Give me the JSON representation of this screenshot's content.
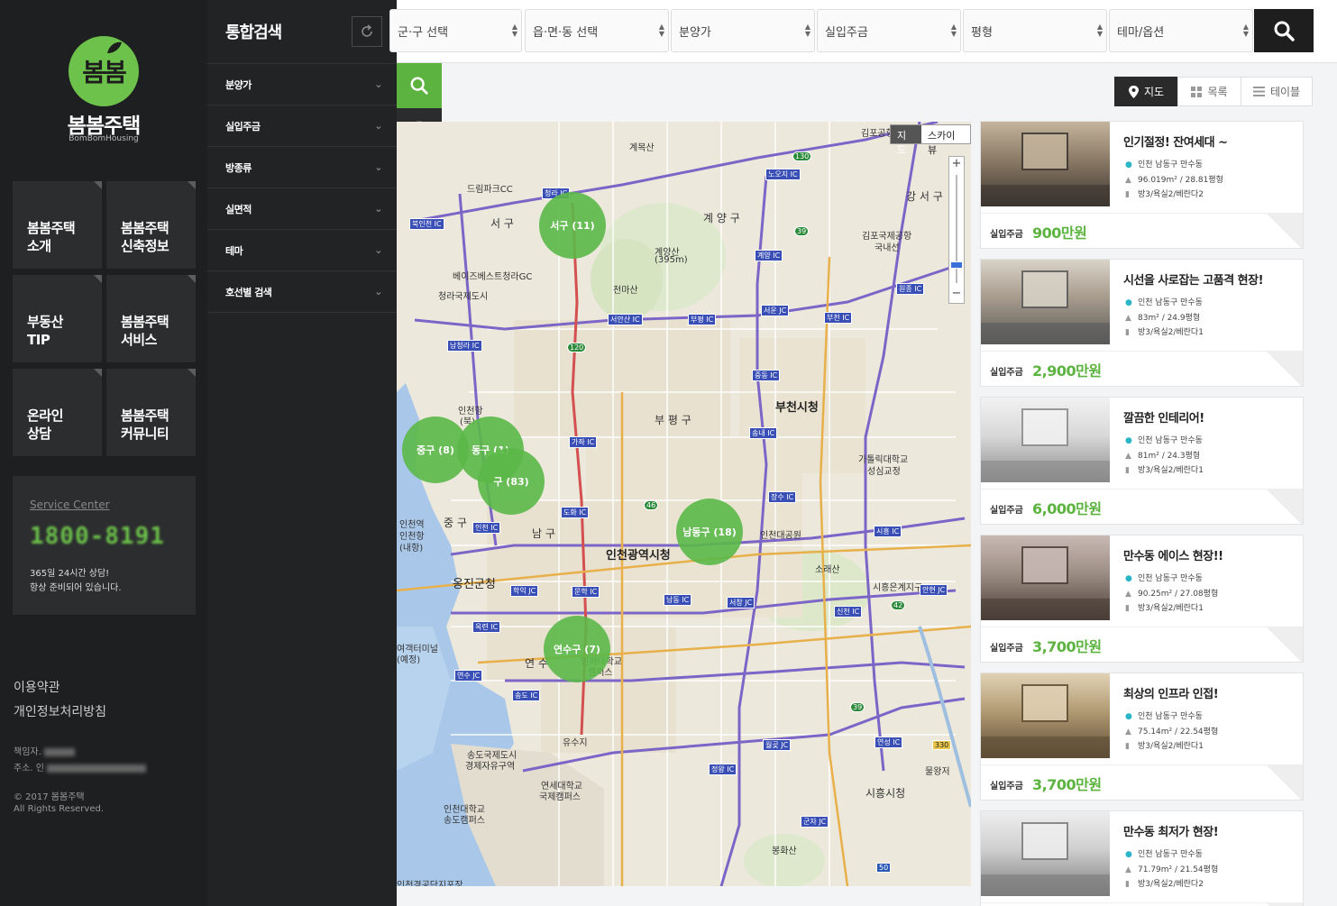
{
  "brand": {
    "logo_text": "봄봄",
    "name": "봄봄주택",
    "subtitle": "BomBomHousing"
  },
  "sidebar": {
    "menu": [
      {
        "line1": "봄봄주택",
        "line2": "소개"
      },
      {
        "line1": "봄봄주택",
        "line2": "신축정보"
      },
      {
        "line1": "부동산",
        "line2": "TIP"
      },
      {
        "line1": "봄봄주택",
        "line2": "서비스"
      },
      {
        "line1": "온라인",
        "line2": "상담"
      },
      {
        "line1": "봄봄주택",
        "line2": "커뮤니티"
      }
    ],
    "service": {
      "title": "Service Center",
      "phone": "1800-8191",
      "line1": "365일 24시간 상담!",
      "line2": "항상 준비되어 있습니다."
    },
    "footer": {
      "terms": "이용약관",
      "privacy": "개인정보처리방침",
      "owner_label": "책임자.",
      "address_label": "주소. 인",
      "copyright": "© 2017 봄봄주택",
      "rights": "All Rights Reserved."
    }
  },
  "panel": {
    "title": "통합검색",
    "refresh_icon": "refresh-icon",
    "filters": [
      "분양가",
      "실입주금",
      "방종류",
      "실면적",
      "테마",
      "호선별 검색"
    ]
  },
  "topbar": {
    "selects": [
      "군·구 선택",
      "읍·면·동 선택",
      "분양가",
      "실입주금",
      "평형",
      "테마/옵션"
    ],
    "search_icon": "search-icon"
  },
  "map_tools": [
    "search-icon",
    "location-pin-icon",
    "subway-train-icon"
  ],
  "view_toggle": [
    {
      "label": "지도",
      "icon": "map-pin-icon",
      "active": true
    },
    {
      "label": "목록",
      "icon": "grid-icon",
      "active": false
    },
    {
      "label": "테이블",
      "icon": "list-icon",
      "active": false
    }
  ],
  "map": {
    "type_buttons": [
      "지도",
      "스카이뷰"
    ],
    "clusters": [
      "서구 (11)",
      "중구 (8)",
      "동구 (1)",
      "구 (83)",
      "남동구 (18)",
      "연수구 (7)"
    ],
    "places": [
      "계목산",
      "김포공항",
      "강 서 구",
      "드림파크CC",
      "서 구",
      "계 양 구",
      "김포국제공항",
      "국내선",
      "계양산",
      "(395m)",
      "베이즈베스트청라GC",
      "청라국제도시",
      "천마산",
      "인천항",
      "(북)",
      "부 평 구",
      "부천시청",
      "가톨릭대학교",
      "성심교정",
      "중 구",
      "인천역",
      "인천항",
      "(내항)",
      "남 구",
      "인천대공원",
      "인천광역시청",
      "소래산",
      "옹진군청",
      "시흥은계지구",
      "연 수",
      "인하대학교",
      "캠퍼스",
      "송도국제도시",
      "경제자유구역",
      "연세대학교",
      "국제캠퍼스",
      "인천대학교",
      "송도캠퍼스",
      "시흥시청",
      "물왕저",
      "봉화산",
      "유수지",
      "여객터미널",
      "(예정)",
      "인천경공단지포장"
    ],
    "ic_labels": [
      "청라 IC",
      "노오지 IC",
      "계양 IC",
      "서안산 IC",
      "부평 IC",
      "서운 JC",
      "부천 IC",
      "원종 IC",
      "북인천 IC",
      "남청라 IC",
      "중동 IC",
      "송내 IC",
      "가좌 IC",
      "장수 IC",
      "인천 IC",
      "도화 IC",
      "학익 JC",
      "문학 IC",
      "남동 IC",
      "서창 JC",
      "신천 IC",
      "안현 JC",
      "시흥 IC",
      "옥련 IC",
      "연수 JC",
      "송도 IC",
      "월곶 JC",
      "정왕 IC",
      "연성 IC",
      "군자 JC"
    ],
    "route_numbers": [
      "130",
      "39",
      "120",
      "46",
      "42",
      "39",
      "330",
      "50"
    ]
  },
  "listings": [
    {
      "title": "인기절정! 잔여세대 ~",
      "address": "인천 남동구 만수동",
      "area": "96.019m² / 28.81평형",
      "rooms": "방3/욕실2/베란다2",
      "price_label": "실입주금",
      "price": "900만원",
      "palette": [
        "#8b7a66",
        "#3c3630",
        "#c4b49c"
      ]
    },
    {
      "title": "시선을 사로잡는 고품격 현장!",
      "address": "인천 남동구 만수동",
      "area": "83m² / 24.9평형",
      "rooms": "방3/욕실2/베란다1",
      "price_label": "실입주금",
      "price": "2,900만원",
      "palette": [
        "#a79b8c",
        "#5a5a5a",
        "#d9d3c8"
      ]
    },
    {
      "title": "깔끔한 인테리어!",
      "address": "인천 남동구 만수동",
      "area": "81m² / 24.3평형",
      "rooms": "방3/욕실2/베란다1",
      "price_label": "실입주금",
      "price": "6,000만원",
      "palette": [
        "#d8d8d8",
        "#8a8a8a",
        "#f2f2f2"
      ]
    },
    {
      "title": "만수동 에이스 현장!!",
      "address": "인천 남동구 만수동",
      "area": "90.25m² / 27.08평형",
      "rooms": "방3/욕실2/베란다1",
      "price_label": "실입주금",
      "price": "3,700만원",
      "palette": [
        "#9c8d84",
        "#4a3d37",
        "#c9b9b4"
      ]
    },
    {
      "title": "최상의 인프라 인접!",
      "address": "인천 남동구 만수동",
      "area": "75.14m² / 22.54평형",
      "rooms": "방3/욕실2/베란다1",
      "price_label": "실입주금",
      "price": "3,700만원",
      "palette": [
        "#b19a73",
        "#5e4c35",
        "#e1d2b5"
      ]
    },
    {
      "title": "만수동 최저가 현장!",
      "address": "인천 남동구 만수동",
      "area": "71.79m² / 21.54평형",
      "rooms": "방3/욕실2/베란다2",
      "price_label": "실입주금",
      "price": "3,700만원",
      "palette": [
        "#cfcfcf",
        "#7b7b7b",
        "#eeeeee"
      ]
    }
  ],
  "colors": {
    "accent": "#6cc24a",
    "price": "#5cb33f",
    "sidebar": "#1e1f20",
    "panel": "#222324"
  }
}
